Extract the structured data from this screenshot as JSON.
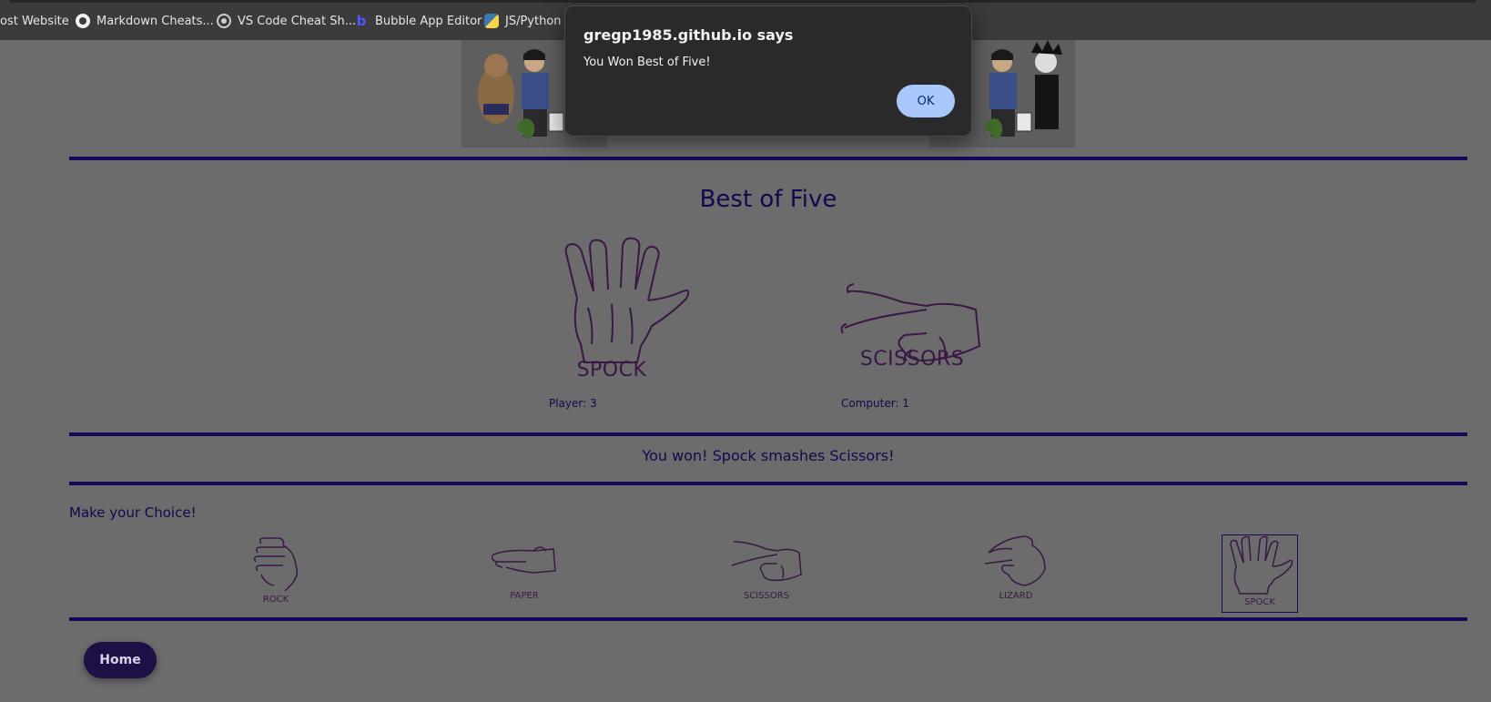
{
  "bookmarks": [
    {
      "label": "ost Website",
      "icon": "none"
    },
    {
      "label": "Markdown Cheats...",
      "icon": "github-icon"
    },
    {
      "label": "VS Code Cheat Sh...",
      "icon": "globe-icon"
    },
    {
      "label": "Bubble App Editor",
      "icon": "bubble-icon"
    },
    {
      "label": "JS/Python T",
      "icon": "python-icon"
    }
  ],
  "game": {
    "title": "Best of Five",
    "player_choice": "SPOCK",
    "computer_choice": "SCISSORS",
    "player_score": "Player: 3",
    "computer_score": "Computer: 1",
    "result": "You won! Spock smashes Scissors!",
    "choose_heading": "Make your Choice!",
    "choices": [
      "ROCK",
      "PAPER",
      "SCISSORS",
      "LIZARD",
      "SPOCK"
    ],
    "selected_choice": "SPOCK",
    "home_label": "Home"
  },
  "dialog": {
    "title": "gregp1985.github.io says",
    "message": "You Won Best of Five!",
    "ok_label": "OK"
  },
  "colors": {
    "accent": "#140a5a",
    "overlay_background": "#6c6c6c",
    "dialog_button": "#a8c7fa"
  }
}
